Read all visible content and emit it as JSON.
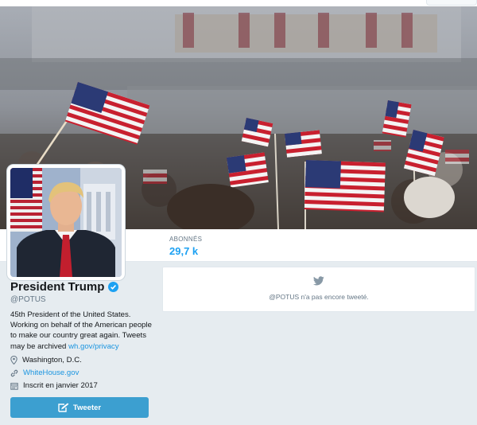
{
  "profile": {
    "name": "President Trump",
    "handle": "@POTUS",
    "bio_text": "45th President of the United States. Working on behalf of the American people to make our country great again. Tweets may be archived",
    "bio_link": "wh.gov/privacy",
    "location": "Washington, D.C.",
    "website": "WhiteHouse.gov",
    "joined": "Inscrit en janvier 2017",
    "verified_badge": "verified-badge-icon",
    "tweet_button": "Tweeter"
  },
  "stats": {
    "followers_label": "ABONNÉS",
    "followers_value": "29,7 k"
  },
  "timeline": {
    "empty_message": "@POTUS n'a pas encore tweeté."
  },
  "colors": {
    "accent": "#1da1f2",
    "link": "#1b95e0",
    "button": "#3c9fd0",
    "background": "#e6ecf0",
    "text": "#14171a",
    "muted": "#657786"
  },
  "icons": {
    "location": "location-pin-icon",
    "website": "link-icon",
    "joined": "calendar-icon",
    "timeline": "twitter-bird-icon",
    "compose": "compose-tweet-icon"
  }
}
